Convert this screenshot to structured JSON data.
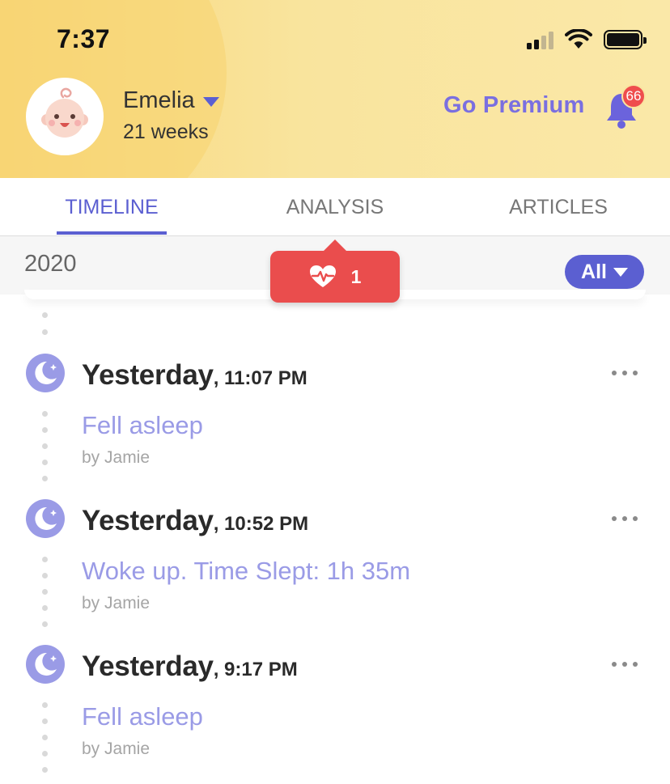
{
  "status_bar": {
    "time": "7:37"
  },
  "profile": {
    "name": "Emelia",
    "age": "21 weeks"
  },
  "header": {
    "premium_label": "Go Premium",
    "notification_count": "66"
  },
  "tabs": [
    {
      "label": "TIMELINE",
      "active": true
    },
    {
      "label": "ANALYSIS",
      "active": false
    },
    {
      "label": "ARTICLES",
      "active": false
    }
  ],
  "filter": {
    "year": "2020",
    "filter_label": "All",
    "health_alert_count": "1"
  },
  "timeline": [
    {
      "day": "Yesterday",
      "time": ", 11:07 PM",
      "title": "Fell asleep",
      "by": "by Jamie",
      "icon": "moon-icon"
    },
    {
      "day": "Yesterday",
      "time": ", 10:52 PM",
      "title": "Woke up. Time Slept: 1h 35m",
      "by": "by Jamie",
      "icon": "moon-icon"
    },
    {
      "day": "Yesterday",
      "time": ", 9:17 PM",
      "title": "Fell asleep",
      "by": "by Jamie",
      "icon": "moon-icon"
    }
  ],
  "colors": {
    "accent": "#5b5fd1",
    "premium": "#7a6fe0",
    "entry_title": "#9a9be6",
    "alert": "#ea4d4d",
    "header_bg": "#f9e49a"
  }
}
